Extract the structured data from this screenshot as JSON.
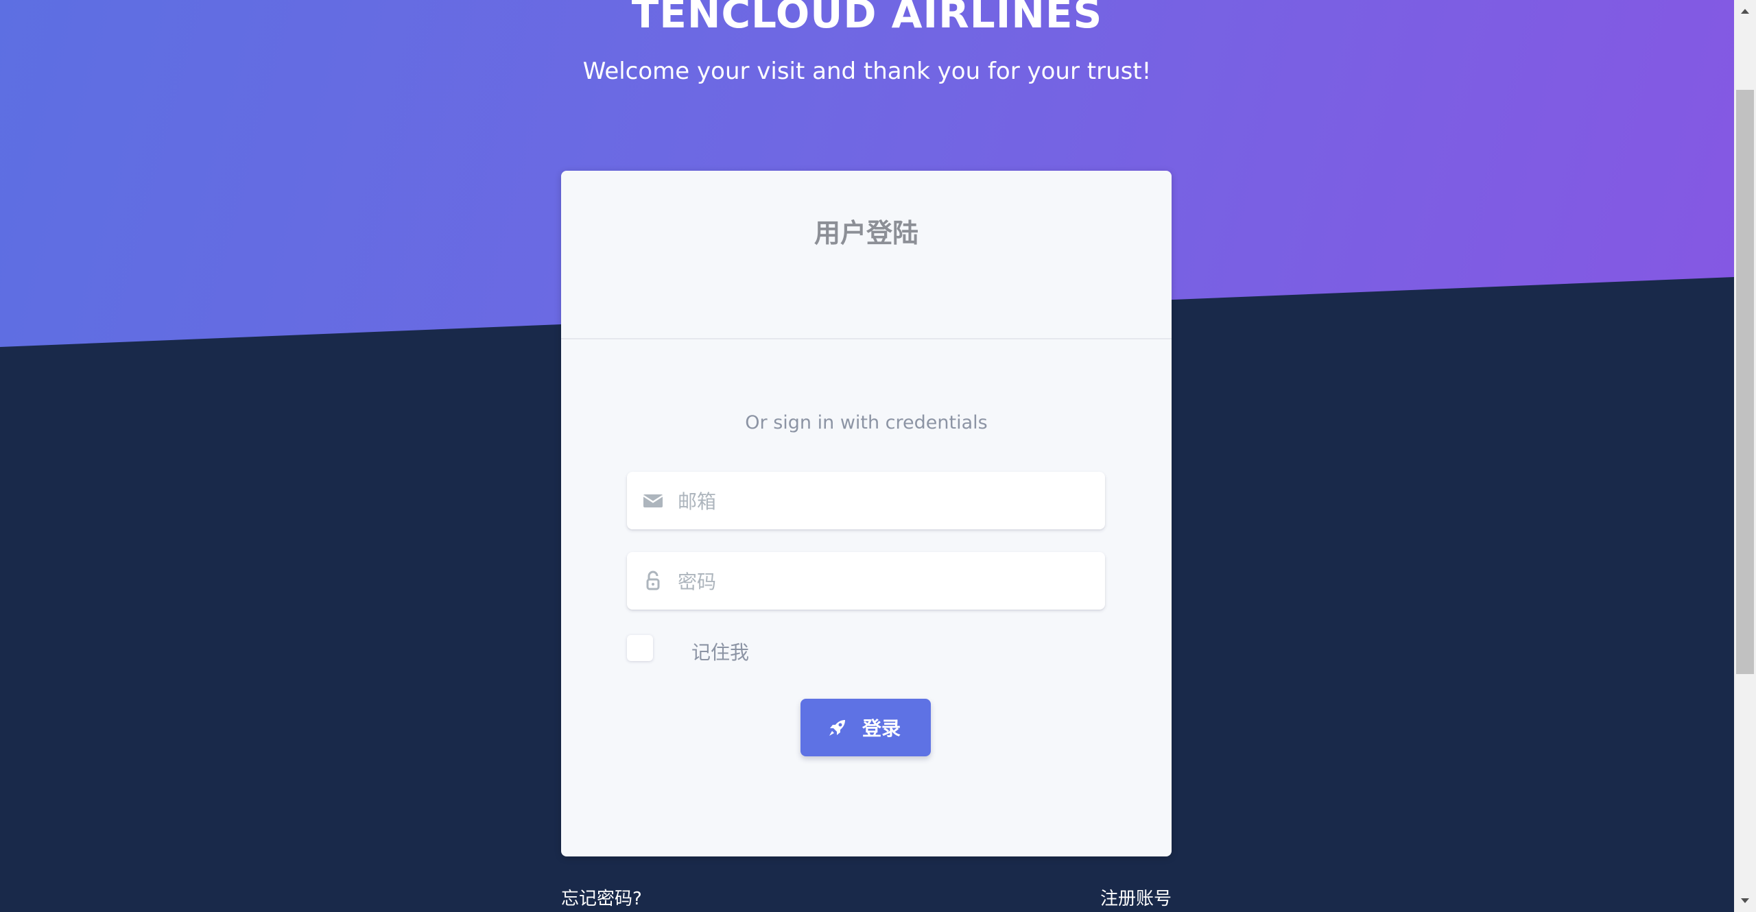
{
  "hero": {
    "title": "TENCLOUD AIRLINES",
    "subtitle": "Welcome your visit and thank you for your trust!"
  },
  "login_card": {
    "title": "用户登陆",
    "hint": "Or sign in with credentials",
    "email": {
      "value": "",
      "placeholder": "邮箱",
      "icon": "envelope-icon"
    },
    "password": {
      "value": "",
      "placeholder": "密码",
      "icon": "unlock-icon"
    },
    "remember_label": "记住我",
    "remember_checked": false,
    "login_button": {
      "label": "登录",
      "icon": "rocket-icon"
    }
  },
  "links": {
    "forgot_password": "忘记密码?",
    "register": "注册账号"
  },
  "colors": {
    "hero_gradient_start": "#5d6fe2",
    "hero_gradient_end": "#8558e3",
    "background": "#19294a",
    "card": "#f6f8fb",
    "primary_button": "#5e72e4"
  }
}
